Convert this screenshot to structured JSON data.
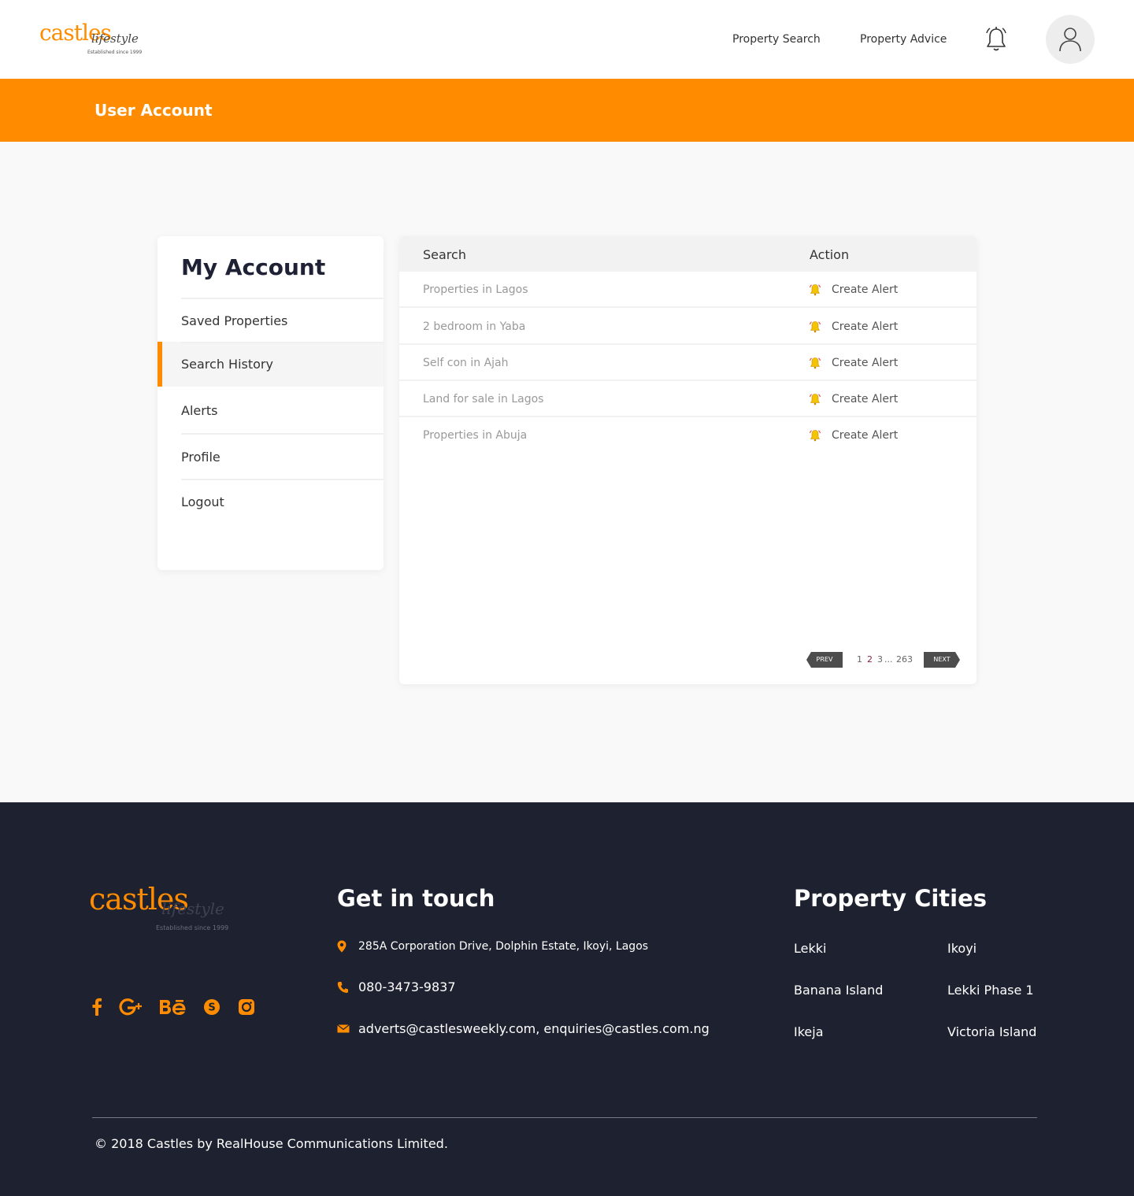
{
  "header": {
    "logo_word": "castles",
    "logo_script": "lifestyle",
    "logo_tagline": "Established since 1999",
    "nav": [
      "Property Search",
      "Property Advice"
    ],
    "icons": [
      "bell-icon",
      "user-icon"
    ]
  },
  "banner": {
    "title": "User Account"
  },
  "sidebar": {
    "title": "My Account",
    "items": [
      {
        "label": "Saved Properties",
        "active": false
      },
      {
        "label": "Search History",
        "active": true
      },
      {
        "label": "Alerts",
        "active": false
      },
      {
        "label": "Profile",
        "active": false
      },
      {
        "label": "Logout",
        "active": false
      }
    ]
  },
  "table": {
    "columns": [
      "Search",
      "Action"
    ],
    "rows": [
      {
        "search": "Properties in Lagos",
        "action": "Create Alert"
      },
      {
        "search": "2 bedroom in Yaba",
        "action": "Create Alert"
      },
      {
        "search": "Self con in Ajah",
        "action": "Create Alert"
      },
      {
        "search": "Land for sale in Lagos",
        "action": "Create Alert"
      },
      {
        "search": "Properties in Abuja",
        "action": "Create Alert"
      }
    ]
  },
  "pagination": {
    "prev": "PREV",
    "next": "NEXT",
    "pages": [
      "1",
      "2",
      "3",
      "...",
      "263"
    ],
    "current": "2"
  },
  "footer": {
    "logo_word": "castles",
    "logo_script": "lifestyle",
    "logo_tagline": "Established since 1999",
    "social": [
      "facebook-icon",
      "google-plus-icon",
      "behance-icon",
      "skype-icon",
      "instagram-icon"
    ],
    "contact_heading": "Get in touch",
    "address": "285A Corporation Drive, Dolphin Estate, Ikoyi, Lagos",
    "phone": "080-3473-9837",
    "email": "adverts@castlesweekly.com, enquiries@castles.com.ng",
    "cities_heading": "Property Cities",
    "cities": [
      "Lekki",
      "Ikoyi",
      "Banana Island",
      "Lekki Phase 1",
      "Ikeja",
      "Victoria Island"
    ],
    "copyright": "© 2018 Castles by RealHouse Communications Limited."
  },
  "colors": {
    "accent": "#ff8c00",
    "footer_bg": "#1e2230",
    "page_bg": "#f9f9f9",
    "alert_icon": "#f5c400",
    "current_page": "#8a1f4c"
  }
}
